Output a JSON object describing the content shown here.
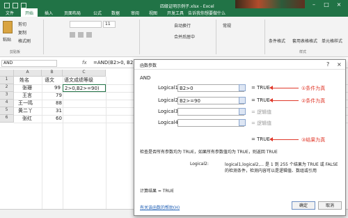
{
  "window": {
    "title": "四级证明示例子.xlsx - Excel",
    "ribbon_tabs": [
      "文件",
      "开始",
      "插入",
      "页面布局",
      "公式",
      "数据",
      "审阅",
      "视图",
      "开发工具"
    ],
    "active_tab": "开始",
    "tell_me": "告诉我你想要做什么"
  },
  "ribbon": {
    "paste": "粘贴",
    "cut": "剪切",
    "copy": "复制",
    "format_painter": "格式刷",
    "clipboard_group": "剪贴板",
    "font_size": "11",
    "auto_wrap": "自动换行",
    "merge_center": "合并后居中",
    "number_format": "常规",
    "cond_format": "条件格式",
    "table_format": "套用表格格式",
    "cell_style": "单元格样式",
    "style_group": "样式"
  },
  "formula_bar": {
    "name_box": "AND",
    "fx": "fx",
    "formula": "=AND(B2>0, B2"
  },
  "grid": {
    "columns": [
      "A",
      "B",
      "C"
    ],
    "rows": [
      {
        "num": "1",
        "a": "姓名",
        "b": "语文",
        "c": "语文成绩等级"
      },
      {
        "num": "2",
        "a": "张珊",
        "b": "99",
        "c": "2>0,B2>=90)"
      },
      {
        "num": "3",
        "a": "王言",
        "b": "79",
        "c": ""
      },
      {
        "num": "4",
        "a": "王一鸣",
        "b": "88",
        "c": ""
      },
      {
        "num": "5",
        "a": "黄二丫",
        "b": "31",
        "c": ""
      },
      {
        "num": "6",
        "a": "张红",
        "b": "60",
        "c": ""
      }
    ]
  },
  "dialog": {
    "title": "函数参数",
    "function_name": "AND",
    "args": [
      {
        "label": "Logical1",
        "value": "B2>0",
        "result": "=  TRUE",
        "muted": false
      },
      {
        "label": "Logical2",
        "value": "B2>=90",
        "result": "=  TRUE",
        "muted": false
      },
      {
        "label": "Logical3",
        "value": "",
        "result": "=  逻辑值",
        "muted": true
      },
      {
        "label": "Logical4",
        "value": "",
        "result": "=  逻辑值",
        "muted": true
      }
    ],
    "total": "=  TRUE",
    "description": "检查是否所有参数均为 TRUE，如果所有参数值均为 TRUE，则返回 TRUE",
    "arg_desc_label": "Logical2:",
    "arg_desc": "logical1,logical2,... 是 1 到 255 个结果为 TRUE 或 FALSE 的检测条件，检测内容可以是逻辑值、数组或引用",
    "calc_result": "计算结果 =  TRUE",
    "help_link": "有关该函数的帮助(H)",
    "ok": "确定",
    "cancel": "取消"
  },
  "annotations": [
    "①条件为真",
    "②条件为真",
    "③结果为真"
  ],
  "colors": {
    "excel_green": "#217346",
    "annotation_red": "#e0392b"
  }
}
